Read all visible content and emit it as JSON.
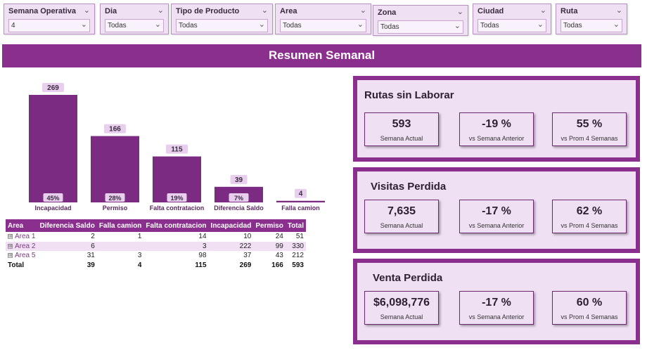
{
  "slicers": [
    {
      "title": "Semana Operativa",
      "value": "4"
    },
    {
      "title": "Dia",
      "value": "Todas"
    },
    {
      "title": "Tipo de Producto",
      "value": "Todas"
    },
    {
      "title": "Area",
      "value": "Todas"
    },
    {
      "title": "Zona",
      "value": "Todas"
    },
    {
      "title": "Ciudad",
      "value": "Todas"
    },
    {
      "title": "Ruta",
      "value": "Todas"
    }
  ],
  "banner": {
    "title": "Resumen Semanal"
  },
  "chart_data": {
    "type": "bar",
    "categories": [
      "Incapacidad",
      "Permiso",
      "Falta contratacion",
      "Diferencia Saldo",
      "Falla camion"
    ],
    "values": [
      269,
      166,
      115,
      39,
      4
    ],
    "percent_labels": [
      "45%",
      "28%",
      "19%",
      "7%",
      ""
    ],
    "color": "#7b2c82",
    "ylim": [
      0,
      269
    ]
  },
  "table": {
    "headers": [
      "Area",
      "Diferencia Saldo",
      "Falla camion",
      "Falta contratacion",
      "Incapacidad",
      "Permiso",
      "Total"
    ],
    "rows": [
      {
        "cells": [
          "Area 1",
          "2",
          "1",
          "14",
          "10",
          "24",
          "51"
        ],
        "expand": "⊞"
      },
      {
        "cells": [
          "Area 2",
          "6",
          "",
          "3",
          "222",
          "99",
          "330"
        ],
        "expand": "⊞"
      },
      {
        "cells": [
          "Area 5",
          "31",
          "3",
          "98",
          "37",
          "43",
          "212"
        ],
        "expand": "⊞"
      }
    ],
    "total": [
      "Total",
      "39",
      "4",
      "115",
      "269",
      "166",
      "593"
    ]
  },
  "panels": [
    {
      "title": "Rutas sin Laborar",
      "kpis": [
        {
          "value": "593",
          "label": "Semana Actual"
        },
        {
          "value": "-19 %",
          "label": "vs Semana Anterior"
        },
        {
          "value": "55 %",
          "label": "vs Prom 4 Semanas"
        }
      ]
    },
    {
      "title": "Visitas Perdida",
      "kpis": [
        {
          "value": "7,635",
          "label": "Semana Actual"
        },
        {
          "value": "-17 %",
          "label": "vs Semana Anterior"
        },
        {
          "value": "62 %",
          "label": "vs Prom 4 Semanas"
        }
      ]
    },
    {
      "title": "Venta Perdida",
      "kpis": [
        {
          "value": "$6,098,776",
          "label": "Semana Actual"
        },
        {
          "value": "-17 %",
          "label": "vs Semana Anterior"
        },
        {
          "value": "60 %",
          "label": "vs Prom 4 Semanas"
        }
      ]
    }
  ],
  "icons": {
    "chevron": "chevron-down-icon",
    "expand": "expand-plus-icon"
  }
}
